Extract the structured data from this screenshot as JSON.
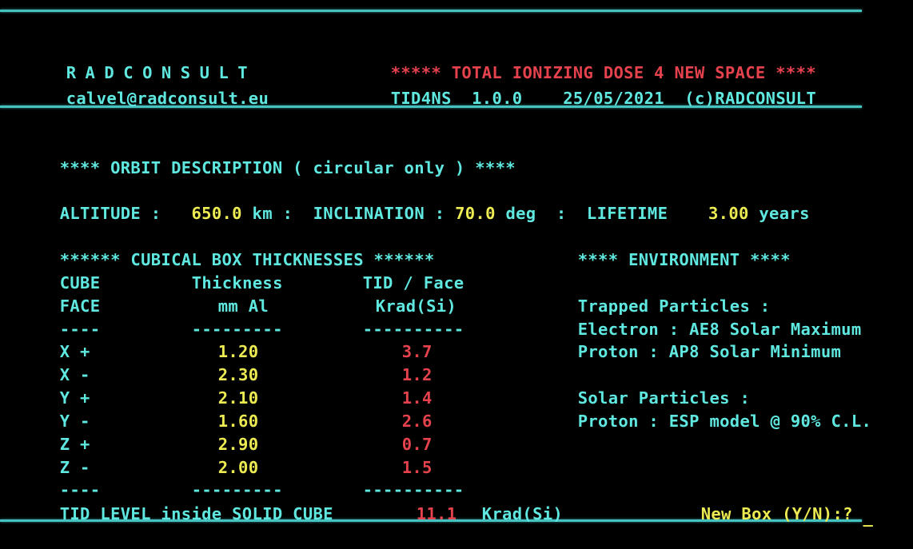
{
  "app": {
    "brand": "RADCONSULT",
    "email": "calvel@radconsult.eu",
    "title_line": "***** TOTAL IONIZING DOSE 4 NEW SPACE ****",
    "program": "TID4NS",
    "version": "1.0.0",
    "date": "25/05/2021",
    "copyright": "(c)RADCONSULT"
  },
  "colors": {
    "background": "#000000",
    "cyan": "#5FE8E0",
    "yellow": "#EDEB52",
    "red": "#E5424E",
    "rule": "#46C3C0"
  },
  "orbit": {
    "heading": "**** ORBIT DESCRIPTION ( circular only ) ****",
    "altitude_label": "ALTITUDE :",
    "altitude_value": "650.0",
    "altitude_unit": "km",
    "sep1": ":",
    "inclination_label": "INCLINATION :",
    "inclination_value": "70.0",
    "inclination_unit": "deg",
    "sep2": ":",
    "lifetime_label": "LIFETIME",
    "lifetime_value": "3.00",
    "lifetime_unit": "years"
  },
  "box": {
    "heading": "****** CUBICAL BOX THICKNESSES ******",
    "col1_head1": "CUBE",
    "col1_head2": "FACE",
    "col2_head1": "Thickness",
    "col2_head2": "mm Al",
    "col3_head1": "TID / Face",
    "col3_head2": "Krad(Si)",
    "rule1": "----",
    "rule2": "---------",
    "rule3": "----------",
    "rows": [
      {
        "face": "X +",
        "thickness": "1.20",
        "tid": "3.7"
      },
      {
        "face": "X -",
        "thickness": "2.30",
        "tid": "1.2"
      },
      {
        "face": "Y +",
        "thickness": "2.10",
        "tid": "1.4"
      },
      {
        "face": "Y -",
        "thickness": "1.60",
        "tid": "2.6"
      },
      {
        "face": "Z +",
        "thickness": "2.90",
        "tid": "0.7"
      },
      {
        "face": "Z -",
        "thickness": "2.00",
        "tid": "1.5"
      }
    ]
  },
  "environment": {
    "heading": "**** ENVIRONMENT ****",
    "trapped_label": "Trapped Particles :",
    "trapped_electron": "Electron : AE8 Solar Maximum",
    "trapped_proton": "Proton : AP8 Solar Minimum",
    "solar_label": "Solar Particles :",
    "solar_proton": "Proton : ESP model @ 90% C.L."
  },
  "summary": {
    "label": "TID LEVEL inside SOLID CUBE",
    "value": "11.1",
    "unit": "Krad(Si)"
  },
  "prompt": {
    "text": "New Box (Y/N):?",
    "cursor": "_"
  }
}
